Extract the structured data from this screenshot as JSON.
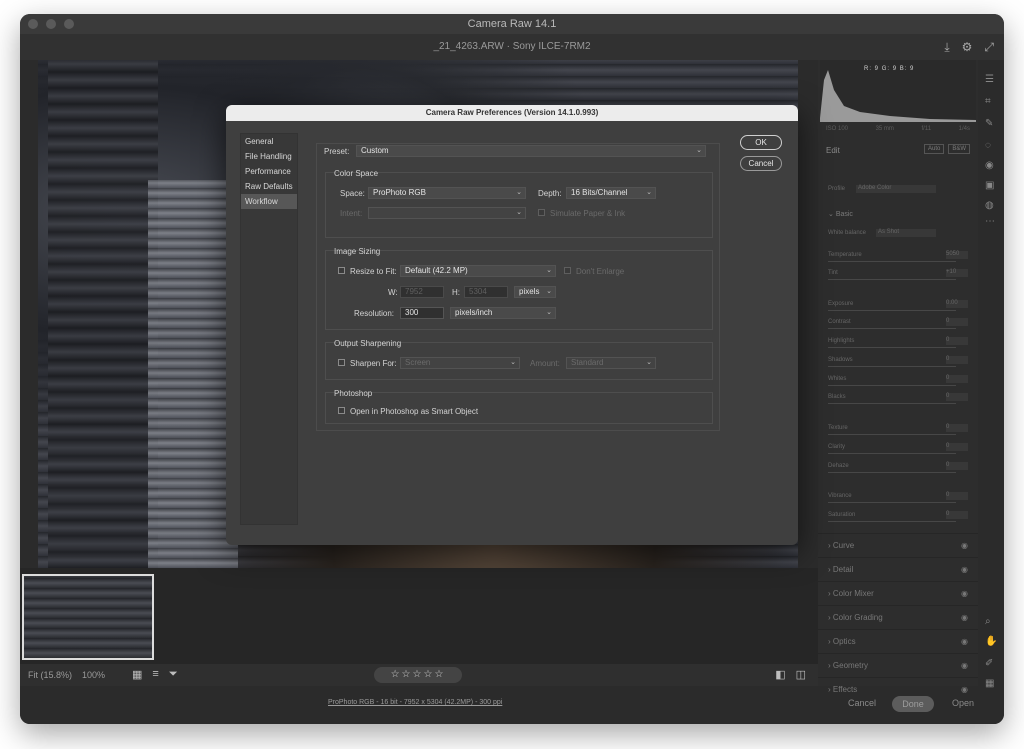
{
  "window": {
    "title": "Camera Raw 14.1",
    "file_label": "_21_4263.ARW  ·  Sony ILCE-7RM2"
  },
  "histogram": {
    "r": "R: 9",
    "g": "G: 9",
    "b": "B: 9"
  },
  "camera_meta": [
    "ISO 100",
    "35 mm",
    "f/11",
    "1/4s"
  ],
  "right_panel": {
    "edit_label": "Edit",
    "auto_label": "Auto",
    "bw_label": "B&W",
    "profile_label": "Profile",
    "profile_value": "Adobe Color",
    "basic_label": "Basic",
    "white_balance_label": "White balance",
    "white_balance_value": "As Shot",
    "sliders": [
      {
        "label": "Temperature",
        "value": "5050"
      },
      {
        "label": "Tint",
        "value": "+10"
      },
      {
        "label": "Exposure",
        "value": "0.00"
      },
      {
        "label": "Contrast",
        "value": "0"
      },
      {
        "label": "Highlights",
        "value": "0"
      },
      {
        "label": "Shadows",
        "value": "0"
      },
      {
        "label": "Whites",
        "value": "0"
      },
      {
        "label": "Blacks",
        "value": "0"
      },
      {
        "label": "Texture",
        "value": "0"
      },
      {
        "label": "Clarity",
        "value": "0"
      },
      {
        "label": "Dehaze",
        "value": "0"
      },
      {
        "label": "Vibrance",
        "value": "0"
      },
      {
        "label": "Saturation",
        "value": "0"
      }
    ],
    "sections": [
      "Curve",
      "Detail",
      "Color Mixer",
      "Color Grading",
      "Optics",
      "Geometry",
      "Effects"
    ]
  },
  "bottom": {
    "fit_label": "Fit (15.8%)",
    "zoom_label": "100%",
    "stars": "☆☆☆☆☆",
    "status_info": "ProPhoto RGB - 16 bit - 7952 x 5304 (42.2MP) - 300 ppi",
    "cancel_label": "Cancel",
    "done_label": "Done",
    "open_label": "Open"
  },
  "dialog": {
    "title": "Camera Raw Preferences  (Version 14.1.0.993)",
    "nav": [
      "General",
      "File Handling",
      "Performance",
      "Raw Defaults",
      "Workflow"
    ],
    "active_nav": "Workflow",
    "ok_label": "OK",
    "cancel_label": "Cancel",
    "preset_label": "Preset:",
    "preset_value": "Custom",
    "color_space": {
      "heading": "Color Space",
      "space_label": "Space:",
      "space_value": "ProPhoto RGB",
      "depth_label": "Depth:",
      "depth_value": "16 Bits/Channel",
      "intent_label": "Intent:",
      "simulate_label": "Simulate Paper & Ink"
    },
    "image_sizing": {
      "heading": "Image Sizing",
      "resize_label": "Resize to Fit:",
      "resize_value": "Default  (42.2 MP)",
      "dont_enlarge_label": "Don't Enlarge",
      "w_label": "W:",
      "w_value": "7952",
      "h_label": "H:",
      "h_value": "5304",
      "unit_value": "pixels",
      "resolution_label": "Resolution:",
      "resolution_value": "300",
      "resolution_unit": "pixels/inch"
    },
    "output_sharpening": {
      "heading": "Output Sharpening",
      "sharpen_label": "Sharpen For:",
      "sharpen_value": "Screen",
      "amount_label": "Amount:",
      "amount_value": "Standard"
    },
    "photoshop": {
      "heading": "Photoshop",
      "smart_object_label": "Open in Photoshop as Smart Object"
    }
  }
}
